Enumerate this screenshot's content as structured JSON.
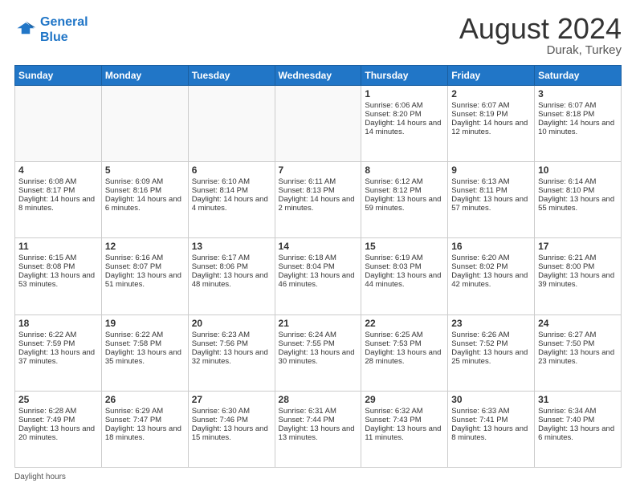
{
  "header": {
    "logo_line1": "General",
    "logo_line2": "Blue",
    "month_title": "August 2024",
    "location": "Durak, Turkey"
  },
  "footer": {
    "label": "Daylight hours"
  },
  "days_of_week": [
    "Sunday",
    "Monday",
    "Tuesday",
    "Wednesday",
    "Thursday",
    "Friday",
    "Saturday"
  ],
  "weeks": [
    [
      {
        "day": "",
        "content": ""
      },
      {
        "day": "",
        "content": ""
      },
      {
        "day": "",
        "content": ""
      },
      {
        "day": "",
        "content": ""
      },
      {
        "day": "1",
        "content": "Sunrise: 6:06 AM\nSunset: 8:20 PM\nDaylight: 14 hours and 14 minutes."
      },
      {
        "day": "2",
        "content": "Sunrise: 6:07 AM\nSunset: 8:19 PM\nDaylight: 14 hours and 12 minutes."
      },
      {
        "day": "3",
        "content": "Sunrise: 6:07 AM\nSunset: 8:18 PM\nDaylight: 14 hours and 10 minutes."
      }
    ],
    [
      {
        "day": "4",
        "content": "Sunrise: 6:08 AM\nSunset: 8:17 PM\nDaylight: 14 hours and 8 minutes."
      },
      {
        "day": "5",
        "content": "Sunrise: 6:09 AM\nSunset: 8:16 PM\nDaylight: 14 hours and 6 minutes."
      },
      {
        "day": "6",
        "content": "Sunrise: 6:10 AM\nSunset: 8:14 PM\nDaylight: 14 hours and 4 minutes."
      },
      {
        "day": "7",
        "content": "Sunrise: 6:11 AM\nSunset: 8:13 PM\nDaylight: 14 hours and 2 minutes."
      },
      {
        "day": "8",
        "content": "Sunrise: 6:12 AM\nSunset: 8:12 PM\nDaylight: 13 hours and 59 minutes."
      },
      {
        "day": "9",
        "content": "Sunrise: 6:13 AM\nSunset: 8:11 PM\nDaylight: 13 hours and 57 minutes."
      },
      {
        "day": "10",
        "content": "Sunrise: 6:14 AM\nSunset: 8:10 PM\nDaylight: 13 hours and 55 minutes."
      }
    ],
    [
      {
        "day": "11",
        "content": "Sunrise: 6:15 AM\nSunset: 8:08 PM\nDaylight: 13 hours and 53 minutes."
      },
      {
        "day": "12",
        "content": "Sunrise: 6:16 AM\nSunset: 8:07 PM\nDaylight: 13 hours and 51 minutes."
      },
      {
        "day": "13",
        "content": "Sunrise: 6:17 AM\nSunset: 8:06 PM\nDaylight: 13 hours and 48 minutes."
      },
      {
        "day": "14",
        "content": "Sunrise: 6:18 AM\nSunset: 8:04 PM\nDaylight: 13 hours and 46 minutes."
      },
      {
        "day": "15",
        "content": "Sunrise: 6:19 AM\nSunset: 8:03 PM\nDaylight: 13 hours and 44 minutes."
      },
      {
        "day": "16",
        "content": "Sunrise: 6:20 AM\nSunset: 8:02 PM\nDaylight: 13 hours and 42 minutes."
      },
      {
        "day": "17",
        "content": "Sunrise: 6:21 AM\nSunset: 8:00 PM\nDaylight: 13 hours and 39 minutes."
      }
    ],
    [
      {
        "day": "18",
        "content": "Sunrise: 6:22 AM\nSunset: 7:59 PM\nDaylight: 13 hours and 37 minutes."
      },
      {
        "day": "19",
        "content": "Sunrise: 6:22 AM\nSunset: 7:58 PM\nDaylight: 13 hours and 35 minutes."
      },
      {
        "day": "20",
        "content": "Sunrise: 6:23 AM\nSunset: 7:56 PM\nDaylight: 13 hours and 32 minutes."
      },
      {
        "day": "21",
        "content": "Sunrise: 6:24 AM\nSunset: 7:55 PM\nDaylight: 13 hours and 30 minutes."
      },
      {
        "day": "22",
        "content": "Sunrise: 6:25 AM\nSunset: 7:53 PM\nDaylight: 13 hours and 28 minutes."
      },
      {
        "day": "23",
        "content": "Sunrise: 6:26 AM\nSunset: 7:52 PM\nDaylight: 13 hours and 25 minutes."
      },
      {
        "day": "24",
        "content": "Sunrise: 6:27 AM\nSunset: 7:50 PM\nDaylight: 13 hours and 23 minutes."
      }
    ],
    [
      {
        "day": "25",
        "content": "Sunrise: 6:28 AM\nSunset: 7:49 PM\nDaylight: 13 hours and 20 minutes."
      },
      {
        "day": "26",
        "content": "Sunrise: 6:29 AM\nSunset: 7:47 PM\nDaylight: 13 hours and 18 minutes."
      },
      {
        "day": "27",
        "content": "Sunrise: 6:30 AM\nSunset: 7:46 PM\nDaylight: 13 hours and 15 minutes."
      },
      {
        "day": "28",
        "content": "Sunrise: 6:31 AM\nSunset: 7:44 PM\nDaylight: 13 hours and 13 minutes."
      },
      {
        "day": "29",
        "content": "Sunrise: 6:32 AM\nSunset: 7:43 PM\nDaylight: 13 hours and 11 minutes."
      },
      {
        "day": "30",
        "content": "Sunrise: 6:33 AM\nSunset: 7:41 PM\nDaylight: 13 hours and 8 minutes."
      },
      {
        "day": "31",
        "content": "Sunrise: 6:34 AM\nSunset: 7:40 PM\nDaylight: 13 hours and 6 minutes."
      }
    ]
  ]
}
